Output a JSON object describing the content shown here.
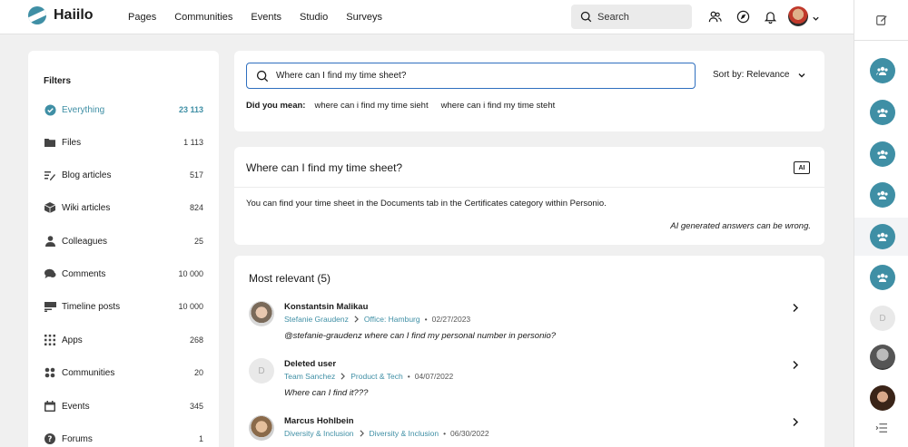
{
  "app": {
    "name": "Haiilo",
    "brand_color": "#3f8fa5"
  },
  "nav": [
    "Pages",
    "Communities",
    "Events",
    "Studio",
    "Surveys"
  ],
  "topbar": {
    "search_label": "Search"
  },
  "filters": {
    "title": "Filters",
    "items": [
      {
        "label": "Everything",
        "count": "23 113",
        "icon": "check-circle-icon",
        "active": true
      },
      {
        "label": "Files",
        "count": "1 113",
        "icon": "folder-icon"
      },
      {
        "label": "Blog articles",
        "count": "517",
        "icon": "blog-icon"
      },
      {
        "label": "Wiki articles",
        "count": "824",
        "icon": "wiki-icon"
      },
      {
        "label": "Colleagues",
        "count": "25",
        "icon": "person-icon"
      },
      {
        "label": "Comments",
        "count": "10 000",
        "icon": "comments-icon"
      },
      {
        "label": "Timeline posts",
        "count": "10 000",
        "icon": "timeline-icon"
      },
      {
        "label": "Apps",
        "count": "268",
        "icon": "apps-grid-icon"
      },
      {
        "label": "Communities",
        "count": "20",
        "icon": "communities-icon"
      },
      {
        "label": "Events",
        "count": "345",
        "icon": "calendar-icon"
      },
      {
        "label": "Forums",
        "count": "1",
        "icon": "question-icon"
      }
    ]
  },
  "search": {
    "query": "Where can I find my time sheet?",
    "sort_label": "Sort by: Relevance",
    "did_you_mean_label": "Did you mean:",
    "suggestions": [
      "where can i find my time sieht",
      "where can i find my time steht"
    ]
  },
  "ai": {
    "question": "Where can I find my time sheet?",
    "badge": "AI",
    "answer": "You can find your time sheet in the Documents tab in the Certificates category within Personio.",
    "disclaimer": "AI generated answers can be wrong."
  },
  "results": {
    "title": "Most relevant (5)",
    "items": [
      {
        "name": "Konstantsin Malikau",
        "from": "Stefanie Graudenz",
        "to": "Office: Hamburg",
        "date": "02/27/2023",
        "snippet": "@stefanie-graudenz where can I find my personal number in personio?"
      },
      {
        "name": "Deleted user",
        "avatar_letter": "D",
        "from": "Team Sanchez",
        "to": "Product & Tech",
        "date": "04/07/2022",
        "snippet": "Where can I find it???"
      },
      {
        "name": "Marcus Hohlbein",
        "from": "Diversity & Inclusion",
        "to": "Diversity & Inclusion",
        "date": "06/30/2022",
        "snippet": ""
      }
    ]
  },
  "rail": {
    "deleted_letter": "D"
  }
}
